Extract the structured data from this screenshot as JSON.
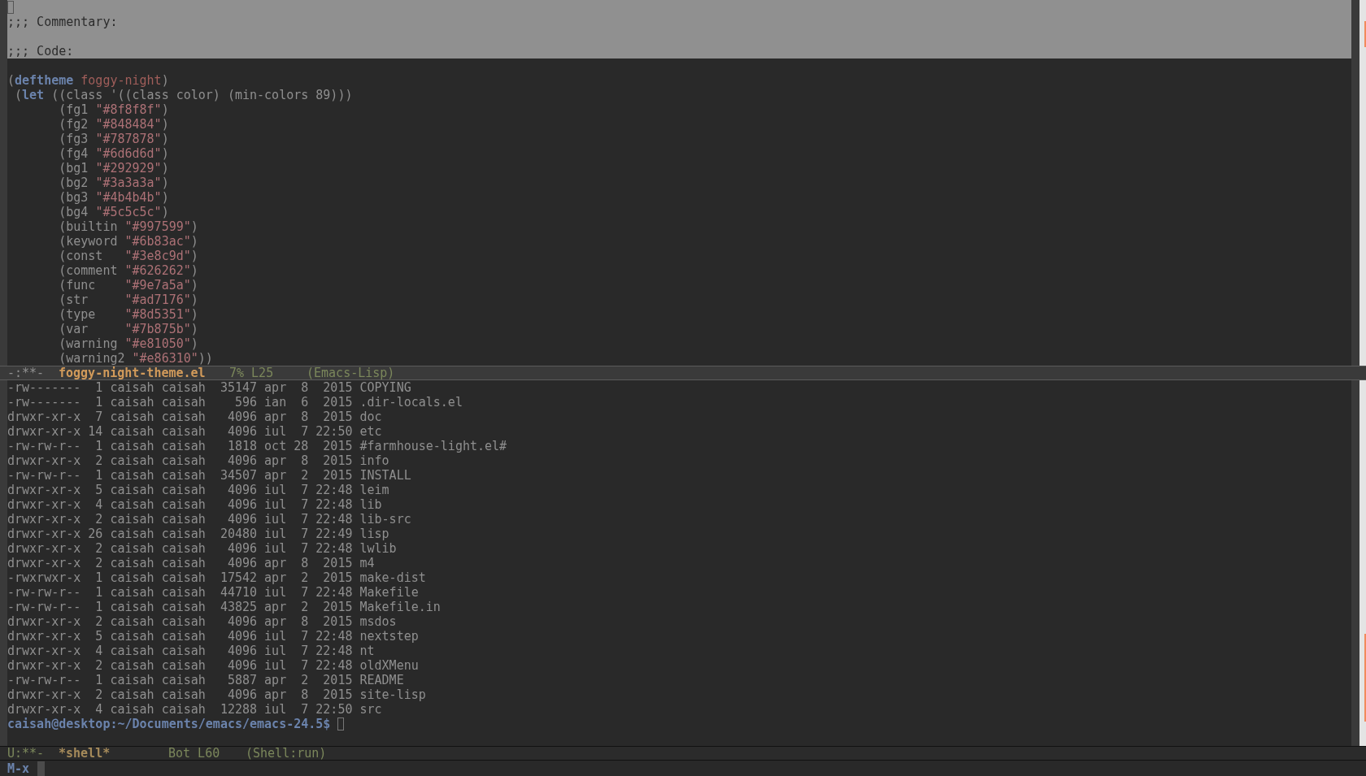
{
  "code_window": {
    "lines": [
      {
        "kind": "blank",
        "highlighted": true,
        "cursor": true
      },
      {
        "kind": "code",
        "highlighted": true,
        "segments": [
          {
            "kind": "comment",
            "text": ";;; Commentary:"
          }
        ]
      },
      {
        "kind": "blank",
        "highlighted": true
      },
      {
        "kind": "code",
        "highlighted": true,
        "segments": [
          {
            "kind": "comment",
            "text": ";;; Code:"
          }
        ]
      },
      {
        "kind": "blank",
        "highlighted": false
      },
      {
        "kind": "code",
        "highlighted": false,
        "segments": [
          {
            "kind": "plain",
            "text": "("
          },
          {
            "kind": "keyword",
            "text": "deftheme"
          },
          {
            "kind": "name",
            "text": " foggy-night"
          },
          {
            "kind": "plain",
            "text": ")"
          }
        ]
      },
      {
        "kind": "code",
        "highlighted": false,
        "segments": [
          {
            "kind": "plain",
            "text": " ("
          },
          {
            "kind": "keyword",
            "text": "let"
          },
          {
            "kind": "plain",
            "text": " ((class '((class color) (min-colors 89)))"
          }
        ]
      },
      {
        "kind": "code",
        "highlighted": false,
        "segments": [
          {
            "kind": "plain",
            "text": "       (fg1 "
          },
          {
            "kind": "string",
            "text": "\"#8f8f8f\""
          },
          {
            "kind": "plain",
            "text": ")"
          }
        ]
      },
      {
        "kind": "code",
        "highlighted": false,
        "segments": [
          {
            "kind": "plain",
            "text": "       (fg2 "
          },
          {
            "kind": "string",
            "text": "\"#848484\""
          },
          {
            "kind": "plain",
            "text": ")"
          }
        ]
      },
      {
        "kind": "code",
        "highlighted": false,
        "segments": [
          {
            "kind": "plain",
            "text": "       (fg3 "
          },
          {
            "kind": "string",
            "text": "\"#787878\""
          },
          {
            "kind": "plain",
            "text": ")"
          }
        ]
      },
      {
        "kind": "code",
        "highlighted": false,
        "segments": [
          {
            "kind": "plain",
            "text": "       (fg4 "
          },
          {
            "kind": "string",
            "text": "\"#6d6d6d\""
          },
          {
            "kind": "plain",
            "text": ")"
          }
        ]
      },
      {
        "kind": "code",
        "highlighted": false,
        "segments": [
          {
            "kind": "plain",
            "text": "       (bg1 "
          },
          {
            "kind": "string",
            "text": "\"#292929\""
          },
          {
            "kind": "plain",
            "text": ")"
          }
        ]
      },
      {
        "kind": "code",
        "highlighted": false,
        "segments": [
          {
            "kind": "plain",
            "text": "       (bg2 "
          },
          {
            "kind": "string",
            "text": "\"#3a3a3a\""
          },
          {
            "kind": "plain",
            "text": ")"
          }
        ]
      },
      {
        "kind": "code",
        "highlighted": false,
        "segments": [
          {
            "kind": "plain",
            "text": "       (bg3 "
          },
          {
            "kind": "string",
            "text": "\"#4b4b4b\""
          },
          {
            "kind": "plain",
            "text": ")"
          }
        ]
      },
      {
        "kind": "code",
        "highlighted": false,
        "segments": [
          {
            "kind": "plain",
            "text": "       (bg4 "
          },
          {
            "kind": "string",
            "text": "\"#5c5c5c\""
          },
          {
            "kind": "plain",
            "text": ")"
          }
        ]
      },
      {
        "kind": "code",
        "highlighted": false,
        "segments": [
          {
            "kind": "plain",
            "text": "       (builtin "
          },
          {
            "kind": "string",
            "text": "\"#997599\""
          },
          {
            "kind": "plain",
            "text": ")"
          }
        ]
      },
      {
        "kind": "code",
        "highlighted": false,
        "segments": [
          {
            "kind": "plain",
            "text": "       (keyword "
          },
          {
            "kind": "string",
            "text": "\"#6b83ac\""
          },
          {
            "kind": "plain",
            "text": ")"
          }
        ]
      },
      {
        "kind": "code",
        "highlighted": false,
        "segments": [
          {
            "kind": "plain",
            "text": "       (const   "
          },
          {
            "kind": "string",
            "text": "\"#3e8c9d\""
          },
          {
            "kind": "plain",
            "text": ")"
          }
        ]
      },
      {
        "kind": "code",
        "highlighted": false,
        "segments": [
          {
            "kind": "plain",
            "text": "       (comment "
          },
          {
            "kind": "string",
            "text": "\"#626262\""
          },
          {
            "kind": "plain",
            "text": ")"
          }
        ]
      },
      {
        "kind": "code",
        "highlighted": false,
        "segments": [
          {
            "kind": "plain",
            "text": "       (func    "
          },
          {
            "kind": "string",
            "text": "\"#9e7a5a\""
          },
          {
            "kind": "plain",
            "text": ")"
          }
        ]
      },
      {
        "kind": "code",
        "highlighted": false,
        "segments": [
          {
            "kind": "plain",
            "text": "       (str     "
          },
          {
            "kind": "string",
            "text": "\"#ad7176\""
          },
          {
            "kind": "plain",
            "text": ")"
          }
        ]
      },
      {
        "kind": "code",
        "highlighted": false,
        "segments": [
          {
            "kind": "plain",
            "text": "       (type    "
          },
          {
            "kind": "string",
            "text": "\"#8d5351\""
          },
          {
            "kind": "plain",
            "text": ")"
          }
        ]
      },
      {
        "kind": "code",
        "highlighted": false,
        "segments": [
          {
            "kind": "plain",
            "text": "       (var     "
          },
          {
            "kind": "string",
            "text": "\"#7b875b\""
          },
          {
            "kind": "plain",
            "text": ")"
          }
        ]
      },
      {
        "kind": "code",
        "highlighted": false,
        "segments": [
          {
            "kind": "plain",
            "text": "       (warning "
          },
          {
            "kind": "string",
            "text": "\"#e81050\""
          },
          {
            "kind": "plain",
            "text": ")"
          }
        ]
      },
      {
        "kind": "code",
        "highlighted": false,
        "segments": [
          {
            "kind": "plain",
            "text": "       (warning2 "
          },
          {
            "kind": "string",
            "text": "\"#e86310\""
          },
          {
            "kind": "plain",
            "text": "))"
          }
        ]
      }
    ]
  },
  "code_mode_line": {
    "active": true,
    "state": "-:**-",
    "buffer": "foggy-night-theme.el",
    "position": "7% L25",
    "mode": "(Emacs-Lisp)"
  },
  "shell_window": {
    "output": [
      "-rw-------  1 caisah caisah  35147 apr  8  2015 COPYING",
      "-rw-------  1 caisah caisah    596 ian  6  2015 .dir-locals.el",
      "drwxr-xr-x  7 caisah caisah   4096 apr  8  2015 doc",
      "drwxr-xr-x 14 caisah caisah   4096 iul  7 22:50 etc",
      "-rw-rw-r--  1 caisah caisah   1818 oct 28  2015 #farmhouse-light.el#",
      "drwxr-xr-x  2 caisah caisah   4096 apr  8  2015 info",
      "-rw-rw-r--  1 caisah caisah  34507 apr  2  2015 INSTALL",
      "drwxr-xr-x  5 caisah caisah   4096 iul  7 22:48 leim",
      "drwxr-xr-x  4 caisah caisah   4096 iul  7 22:48 lib",
      "drwxr-xr-x  2 caisah caisah   4096 iul  7 22:48 lib-src",
      "drwxr-xr-x 26 caisah caisah  20480 iul  7 22:49 lisp",
      "drwxr-xr-x  2 caisah caisah   4096 iul  7 22:48 lwlib",
      "drwxr-xr-x  2 caisah caisah   4096 apr  8  2015 m4",
      "-rwxrwxr-x  1 caisah caisah  17542 apr  2  2015 make-dist",
      "-rw-rw-r--  1 caisah caisah  44710 iul  7 22:48 Makefile",
      "-rw-rw-r--  1 caisah caisah  43825 apr  2  2015 Makefile.in",
      "drwxr-xr-x  2 caisah caisah   4096 apr  8  2015 msdos",
      "drwxr-xr-x  5 caisah caisah   4096 iul  7 22:48 nextstep",
      "drwxr-xr-x  4 caisah caisah   4096 iul  7 22:48 nt",
      "drwxr-xr-x  2 caisah caisah   4096 iul  7 22:48 oldXMenu",
      "-rw-rw-r--  1 caisah caisah   5887 apr  2  2015 README",
      "drwxr-xr-x  2 caisah caisah   4096 apr  8  2015 site-lisp",
      "drwxr-xr-x  4 caisah caisah  12288 iul  7 22:50 src"
    ],
    "prompt": "caisah@desktop:~/Documents/emacs/emacs-24.5$"
  },
  "shell_mode_line": {
    "active": false,
    "state": "U:**-",
    "buffer": "*shell*",
    "position": "Bot L60",
    "mode": "(Shell:run)"
  },
  "minibuffer": {
    "text": "M-x"
  }
}
